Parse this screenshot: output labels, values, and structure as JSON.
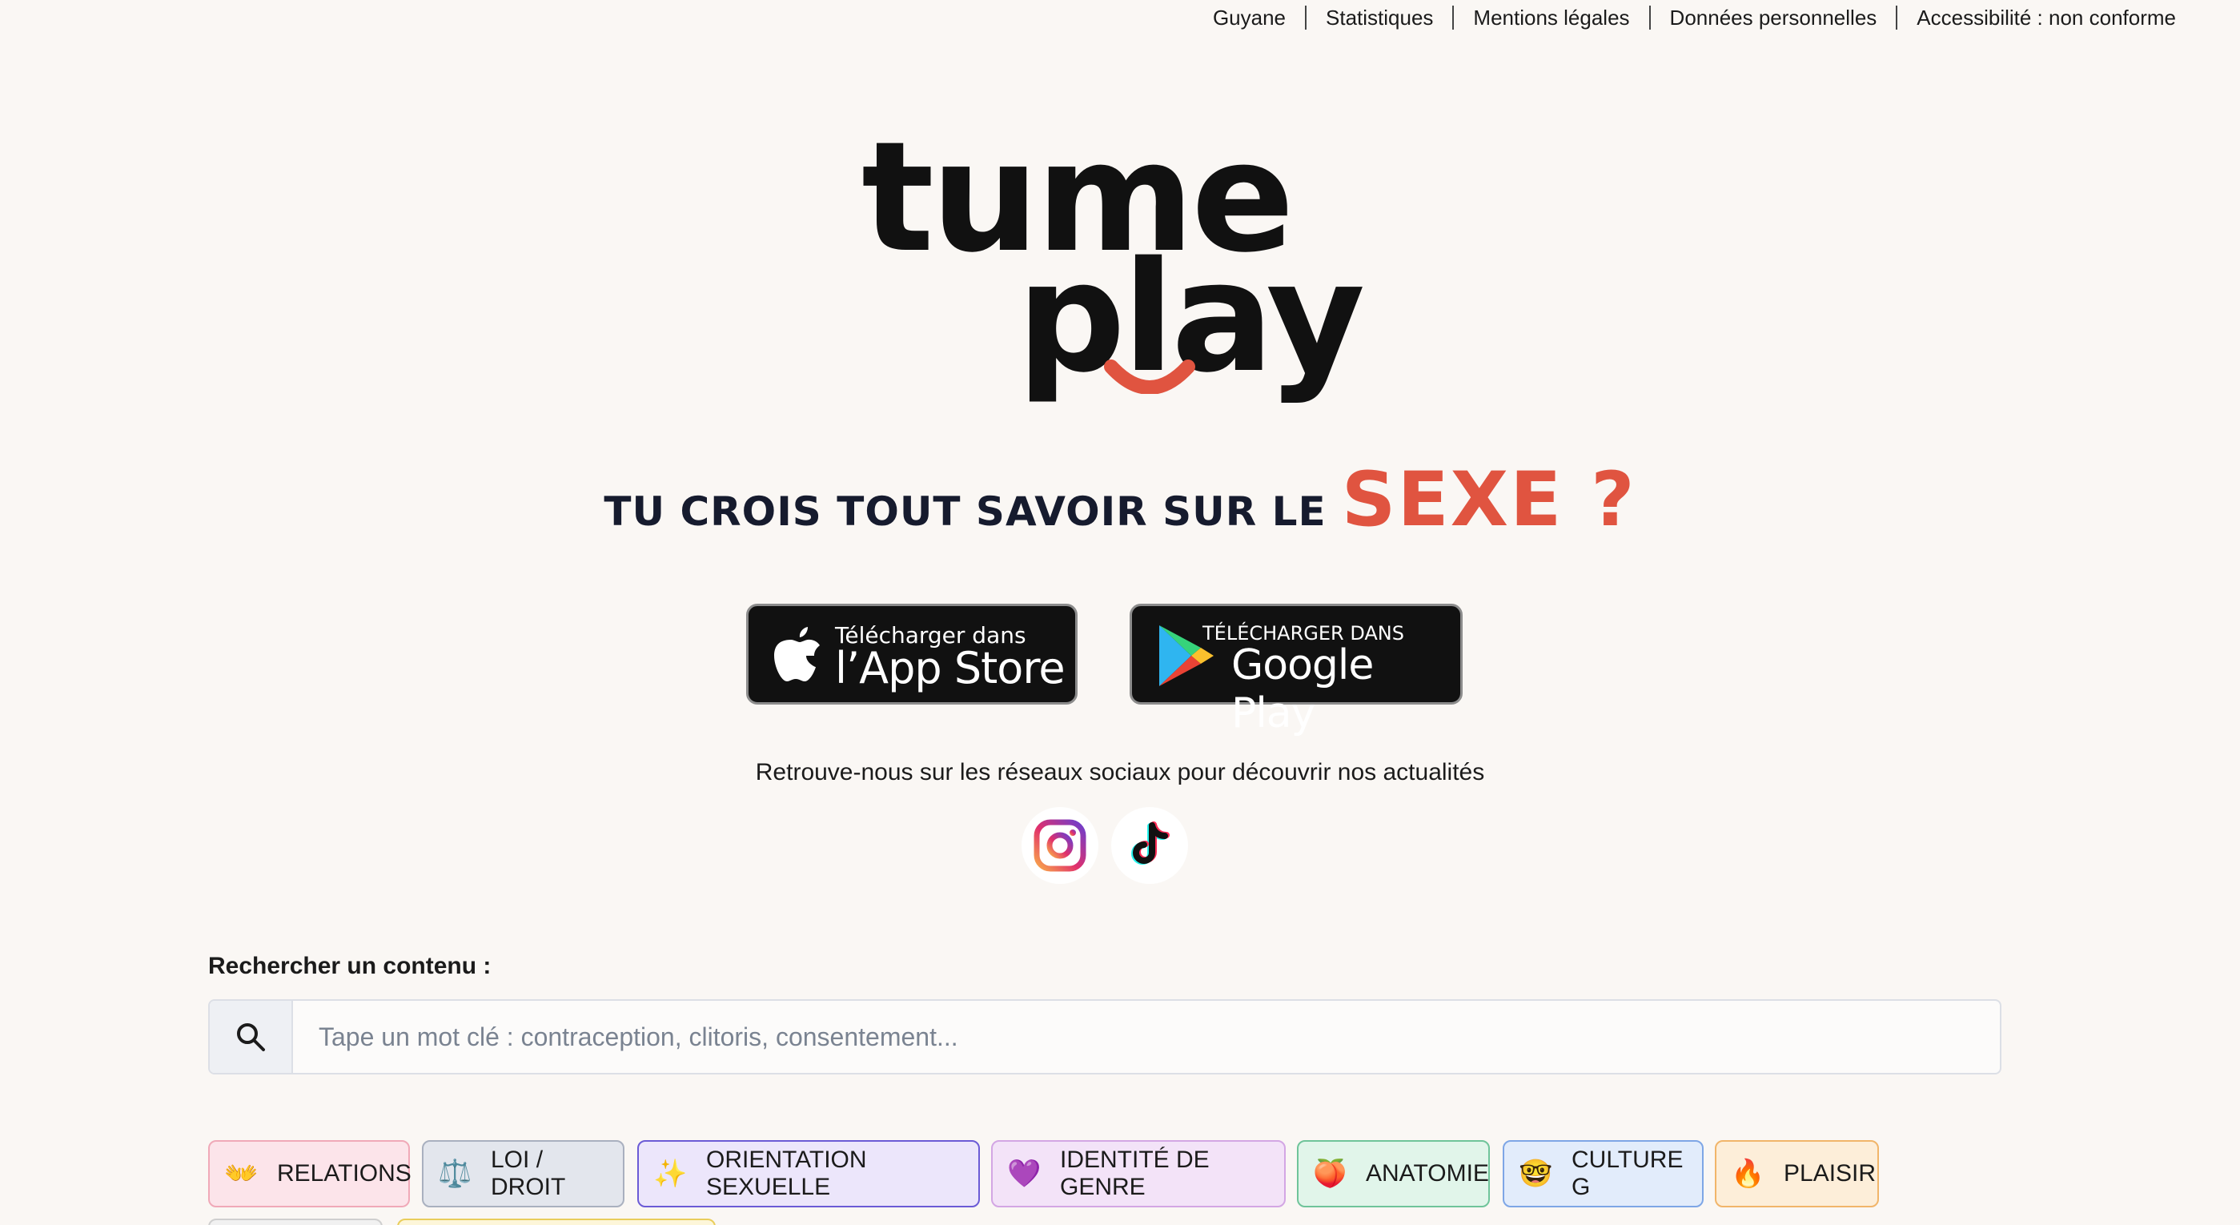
{
  "nav": {
    "links": [
      "Guyane",
      "Statistiques",
      "Mentions légales",
      "Données personnelles",
      "Accessibilité : non conforme"
    ]
  },
  "logo": {
    "line1": "tume",
    "line2": "play",
    "accent_color": "#e05440"
  },
  "headline": {
    "main": "TU CROIS TOUT SAVOIR SUR LE",
    "accent": "SEXE ?"
  },
  "stores": {
    "apple": {
      "small": "Télécharger dans",
      "big": "l’App Store",
      "icon": "apple-logo-icon"
    },
    "google": {
      "small": "TÉLÉCHARGER DANS",
      "big": "Google Play",
      "icon": "google-play-icon"
    }
  },
  "social": {
    "text": "Retrouve-nous sur les réseaux sociaux pour découvrir nos actualités",
    "icons": [
      "instagram-icon",
      "tiktok-icon"
    ]
  },
  "search": {
    "label": "Rechercher un contenu :",
    "placeholder": "Tape un mot clé : contraception, clitoris, consentement...",
    "value": ""
  },
  "categories": [
    {
      "label": "RELATIONS",
      "emoji": "👐",
      "bg": "#fce4ea",
      "border": "#f0a9b8"
    },
    {
      "label": "LOI / DROIT",
      "emoji": "⚖️",
      "bg": "#e3e6ed",
      "border": "#a9b0bf"
    },
    {
      "label": "ORIENTATION SEXUELLE",
      "emoji": "✨",
      "bg": "#ece6fb",
      "border": "#6b5bd6"
    },
    {
      "label": "IDENTITÉ DE GENRE",
      "emoji": "💜",
      "bg": "#f3e3f8",
      "border": "#d3a6e4"
    },
    {
      "label": "ANATOMIE",
      "emoji": "🍑",
      "bg": "#e1f5ea",
      "border": "#6fc49a"
    },
    {
      "label": "CULTURE G",
      "emoji": "🤓",
      "bg": "#e2ecfb",
      "border": "#7ea6e6"
    },
    {
      "label": "PLAISIR",
      "emoji": "🔥",
      "bg": "#fdeed9",
      "border": "#f1b56a"
    }
  ]
}
